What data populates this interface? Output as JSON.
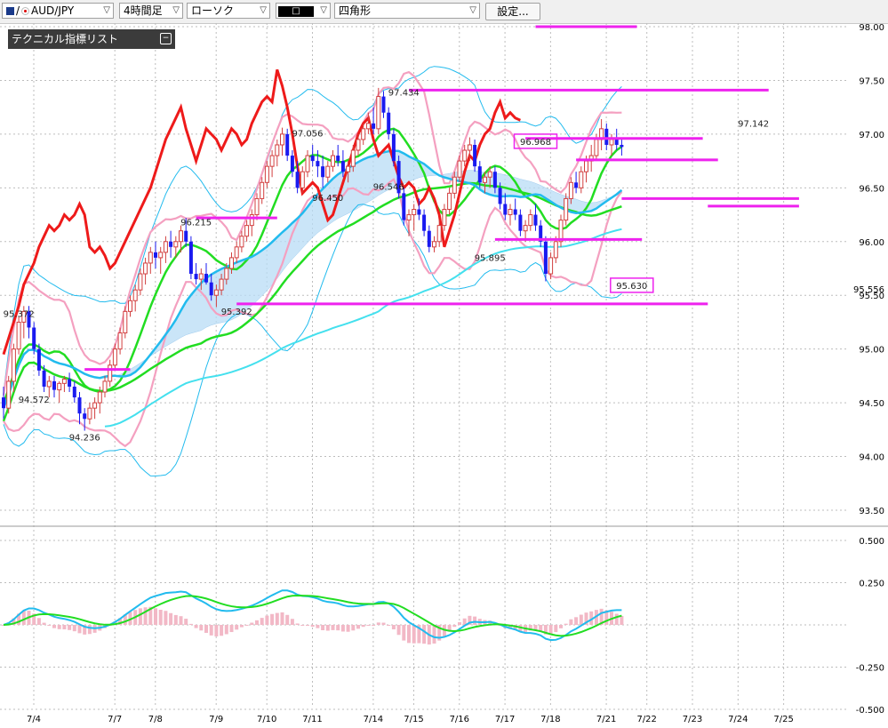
{
  "toolbar": {
    "pair": "AUD/JPY",
    "timeframe": "4時間足",
    "chart_type": "ローソク",
    "draw_mode": "四角形",
    "settings_label": "設定..."
  },
  "indicator_panel": {
    "title": "テクニカル指標リスト"
  },
  "colors": {
    "candle_up": "#d23f3f",
    "candle_down": "#1a1af0",
    "line_red": "#ee1a1a",
    "line_green": "#22dd22",
    "line_cyan": "#22bbee",
    "line_pink": "#f4a0c0",
    "cloud_blue": "#b8dcf6",
    "cloud_pink": "#f8c8dc",
    "hline": "#ee22ee",
    "macd_hist": "#f2b8c6"
  },
  "chart_data": [
    {
      "type": "candlestick",
      "title": "",
      "ylim": [
        93.25,
        98.0
      ],
      "yticks": [
        "98.00",
        "97.50",
        "97.00",
        "96.50",
        "96.00",
        "95.50",
        "95.00",
        "94.50",
        "94.00",
        "93.50"
      ],
      "xticks": [
        "7/4",
        "7/7",
        "7/8",
        "7/9",
        "7/10",
        "7/11",
        "7/14",
        "7/15",
        "7/16",
        "7/17",
        "7/18",
        "7/21",
        "7/22",
        "7/23",
        "7/24",
        "7/25"
      ],
      "last_price": "95.556",
      "annotations": [
        {
          "text": "95.372",
          "x": 3,
          "y": 95.35
        },
        {
          "text": "94.572",
          "x": 6,
          "y": 94.55
        },
        {
          "text": "94.236",
          "x": 16,
          "y": 94.2
        },
        {
          "text": "96.215",
          "x": 38,
          "y": 96.2
        },
        {
          "text": "95.392",
          "x": 46,
          "y": 95.37
        },
        {
          "text": "97.056",
          "x": 60,
          "y": 97.03
        },
        {
          "text": "96.450",
          "x": 64,
          "y": 96.43
        },
        {
          "text": "97.434",
          "x": 79,
          "y": 97.41
        },
        {
          "text": "96.546",
          "x": 76,
          "y": 96.53
        },
        {
          "text": "95.895",
          "x": 96,
          "y": 95.87
        },
        {
          "text": "96.968",
          "x": 105,
          "y": 96.95,
          "boxed": true
        },
        {
          "text": "95.630",
          "x": 124,
          "y": 95.61,
          "boxed": true
        },
        {
          "text": "97.142",
          "x": 148,
          "y": 97.12
        }
      ],
      "horizontal_lines": [
        {
          "y": 98.0,
          "x1": 105,
          "x2": 125
        },
        {
          "y": 97.41,
          "x1": 80,
          "x2": 151
        },
        {
          "y": 96.96,
          "x1": 103,
          "x2": 138
        },
        {
          "y": 96.76,
          "x1": 113,
          "x2": 141
        },
        {
          "y": 96.4,
          "x1": 122,
          "x2": 157
        },
        {
          "y": 96.33,
          "x1": 139,
          "x2": 157
        },
        {
          "y": 96.22,
          "x1": 38,
          "x2": 54
        },
        {
          "y": 96.02,
          "x1": 97,
          "x2": 126
        },
        {
          "y": 95.42,
          "x1": 46,
          "x2": 139
        },
        {
          "y": 94.81,
          "x1": 16,
          "x2": 25
        }
      ],
      "candles": [
        [
          94.55,
          94.65,
          94.35,
          94.45
        ],
        [
          94.45,
          94.75,
          94.4,
          94.7
        ],
        [
          94.7,
          95.05,
          94.6,
          95.0
        ],
        [
          95.0,
          95.3,
          94.95,
          95.25
        ],
        [
          95.25,
          95.4,
          95.1,
          95.35
        ],
        [
          95.35,
          95.4,
          95.1,
          95.2
        ],
        [
          95.2,
          95.25,
          94.95,
          95.0
        ],
        [
          95.0,
          95.05,
          94.75,
          94.8
        ],
        [
          94.8,
          94.85,
          94.6,
          94.65
        ],
        [
          94.65,
          94.75,
          94.55,
          94.7
        ],
        [
          94.7,
          94.75,
          94.55,
          94.62
        ],
        [
          94.62,
          94.7,
          94.5,
          94.68
        ],
        [
          94.68,
          94.75,
          94.6,
          94.72
        ],
        [
          94.72,
          94.78,
          94.6,
          94.65
        ],
        [
          94.65,
          94.7,
          94.5,
          94.55
        ],
        [
          94.55,
          94.6,
          94.3,
          94.4
        ],
        [
          94.4,
          94.45,
          94.24,
          94.35
        ],
        [
          94.35,
          94.5,
          94.3,
          94.45
        ],
        [
          94.45,
          94.55,
          94.35,
          94.5
        ],
        [
          94.5,
          94.65,
          94.4,
          94.6
        ],
        [
          94.6,
          94.75,
          94.55,
          94.7
        ],
        [
          94.7,
          94.9,
          94.65,
          94.85
        ],
        [
          94.85,
          95.05,
          94.8,
          95.0
        ],
        [
          95.0,
          95.2,
          94.95,
          95.15
        ],
        [
          95.15,
          95.4,
          95.1,
          95.35
        ],
        [
          95.35,
          95.5,
          95.3,
          95.45
        ],
        [
          95.45,
          95.6,
          95.35,
          95.55
        ],
        [
          95.55,
          95.75,
          95.5,
          95.7
        ],
        [
          95.7,
          95.85,
          95.6,
          95.8
        ],
        [
          95.8,
          95.95,
          95.7,
          95.9
        ],
        [
          95.9,
          96.0,
          95.75,
          95.85
        ],
        [
          95.85,
          95.95,
          95.7,
          95.9
        ],
        [
          95.9,
          96.05,
          95.8,
          96.0
        ],
        [
          96.0,
          96.1,
          95.85,
          95.95
        ],
        [
          95.95,
          96.05,
          95.85,
          96.0
        ],
        [
          96.0,
          96.15,
          95.9,
          96.1
        ],
        [
          96.1,
          96.22,
          95.95,
          96.0
        ],
        [
          96.0,
          96.05,
          95.65,
          95.7
        ],
        [
          95.7,
          95.8,
          95.6,
          95.65
        ],
        [
          95.65,
          95.75,
          95.55,
          95.7
        ],
        [
          95.7,
          95.8,
          95.6,
          95.62
        ],
        [
          95.62,
          95.7,
          95.45,
          95.5
        ],
        [
          95.5,
          95.6,
          95.39,
          95.55
        ],
        [
          95.55,
          95.7,
          95.5,
          95.65
        ],
        [
          95.65,
          95.8,
          95.6,
          95.75
        ],
        [
          95.75,
          95.9,
          95.7,
          95.85
        ],
        [
          95.85,
          96.0,
          95.8,
          95.95
        ],
        [
          95.95,
          96.1,
          95.9,
          96.05
        ],
        [
          96.05,
          96.2,
          96.0,
          96.15
        ],
        [
          96.15,
          96.3,
          96.05,
          96.25
        ],
        [
          96.25,
          96.45,
          96.2,
          96.4
        ],
        [
          96.4,
          96.6,
          96.35,
          96.55
        ],
        [
          96.55,
          96.75,
          96.5,
          96.7
        ],
        [
          96.7,
          96.85,
          96.6,
          96.8
        ],
        [
          96.8,
          96.95,
          96.7,
          96.9
        ],
        [
          96.9,
          97.06,
          96.8,
          97.0
        ],
        [
          97.0,
          97.05,
          96.75,
          96.8
        ],
        [
          96.8,
          96.85,
          96.6,
          96.65
        ],
        [
          96.65,
          96.75,
          96.45,
          96.5
        ],
        [
          96.5,
          96.7,
          96.45,
          96.65
        ],
        [
          96.65,
          96.85,
          96.6,
          96.8
        ],
        [
          96.8,
          96.9,
          96.7,
          96.75
        ],
        [
          96.75,
          96.85,
          96.6,
          96.7
        ],
        [
          96.7,
          96.8,
          96.5,
          96.6
        ],
        [
          96.6,
          96.75,
          96.55,
          96.7
        ],
        [
          96.7,
          96.85,
          96.65,
          96.8
        ],
        [
          96.8,
          96.9,
          96.7,
          96.75
        ],
        [
          96.75,
          96.85,
          96.6,
          96.65
        ],
        [
          96.65,
          96.75,
          96.55,
          96.7
        ],
        [
          96.7,
          96.9,
          96.65,
          96.85
        ],
        [
          96.85,
          97.0,
          96.8,
          96.95
        ],
        [
          96.95,
          97.1,
          96.9,
          97.05
        ],
        [
          97.05,
          97.2,
          97.0,
          97.1
        ],
        [
          97.1,
          97.25,
          97.0,
          97.05
        ],
        [
          97.05,
          97.43,
          97.0,
          97.35
        ],
        [
          97.35,
          97.4,
          97.15,
          97.2
        ],
        [
          97.2,
          97.25,
          96.95,
          97.0
        ],
        [
          97.0,
          97.05,
          96.7,
          96.75
        ],
        [
          96.75,
          96.8,
          96.4,
          96.45
        ],
        [
          96.45,
          96.5,
          96.15,
          96.2
        ],
        [
          96.2,
          96.3,
          96.05,
          96.25
        ],
        [
          96.25,
          96.35,
          96.1,
          96.3
        ],
        [
          96.3,
          96.4,
          96.2,
          96.25
        ],
        [
          96.25,
          96.3,
          96.05,
          96.1
        ],
        [
          96.1,
          96.15,
          95.9,
          95.95
        ],
        [
          95.95,
          96.05,
          95.9,
          96.0
        ],
        [
          96.0,
          96.2,
          95.95,
          96.15
        ],
        [
          96.15,
          96.35,
          96.1,
          96.3
        ],
        [
          96.3,
          96.5,
          96.25,
          96.45
        ],
        [
          96.45,
          96.65,
          96.4,
          96.6
        ],
        [
          96.6,
          96.8,
          96.55,
          96.75
        ],
        [
          96.75,
          96.9,
          96.7,
          96.85
        ],
        [
          96.85,
          96.97,
          96.75,
          96.9
        ],
        [
          96.9,
          96.95,
          96.65,
          96.7
        ],
        [
          96.7,
          96.75,
          96.5,
          96.55
        ],
        [
          96.55,
          96.65,
          96.45,
          96.6
        ],
        [
          96.6,
          96.7,
          96.5,
          96.65
        ],
        [
          96.65,
          96.7,
          96.45,
          96.5
        ],
        [
          96.5,
          96.55,
          96.3,
          96.35
        ],
        [
          96.35,
          96.45,
          96.2,
          96.25
        ],
        [
          96.25,
          96.35,
          96.15,
          96.3
        ],
        [
          96.3,
          96.4,
          96.2,
          96.25
        ],
        [
          96.25,
          96.3,
          96.05,
          96.1
        ],
        [
          96.1,
          96.2,
          96.0,
          96.15
        ],
        [
          96.15,
          96.3,
          96.1,
          96.25
        ],
        [
          96.25,
          96.35,
          96.1,
          96.15
        ],
        [
          96.15,
          96.2,
          95.95,
          96.0
        ],
        [
          96.0,
          96.05,
          95.63,
          95.7
        ],
        [
          95.7,
          95.9,
          95.65,
          95.85
        ],
        [
          95.85,
          96.05,
          95.8,
          96.0
        ],
        [
          96.0,
          96.25,
          95.95,
          96.2
        ],
        [
          96.2,
          96.45,
          96.15,
          96.4
        ],
        [
          96.4,
          96.6,
          96.35,
          96.55
        ],
        [
          96.55,
          96.65,
          96.45,
          96.5
        ],
        [
          96.5,
          96.7,
          96.45,
          96.65
        ],
        [
          96.65,
          96.8,
          96.55,
          96.75
        ],
        [
          96.75,
          96.9,
          96.65,
          96.8
        ],
        [
          96.8,
          97.0,
          96.75,
          96.95
        ],
        [
          96.95,
          97.14,
          96.85,
          97.05
        ],
        [
          97.05,
          97.1,
          96.85,
          96.9
        ],
        [
          96.9,
          97.0,
          96.8,
          96.95
        ],
        [
          96.95,
          97.05,
          96.85,
          96.9
        ],
        [
          96.9,
          96.95,
          96.8,
          96.88
        ]
      ]
    },
    {
      "type": "line",
      "title": "",
      "ylim": [
        -0.5,
        0.5
      ],
      "yticks": [
        "0.500",
        "0.250",
        "-0.250",
        "-0.500"
      ],
      "series_style": [
        "macd_line",
        "signal_line",
        "histogram"
      ]
    }
  ]
}
